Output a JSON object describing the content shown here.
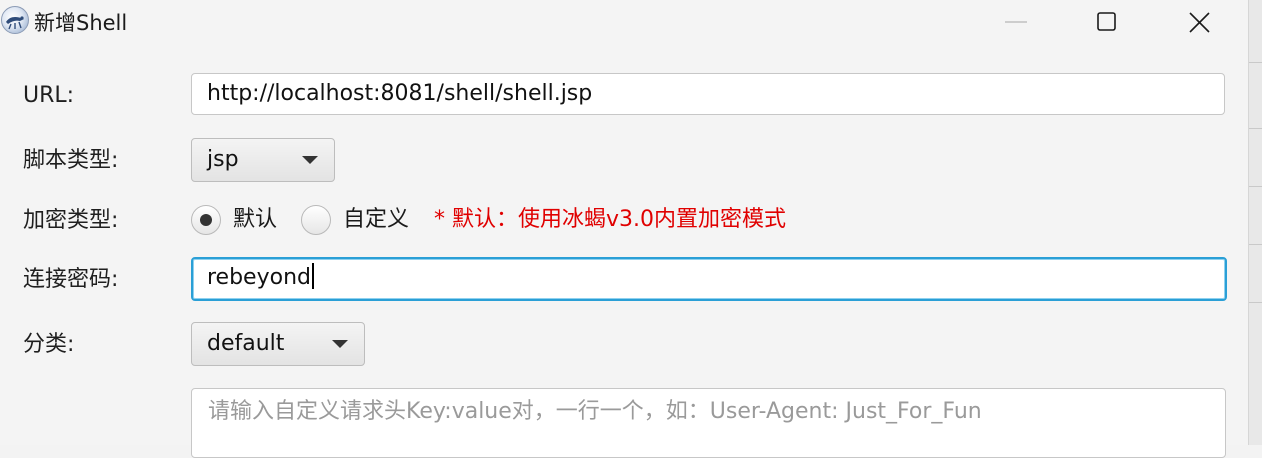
{
  "window": {
    "title": "新增Shell",
    "icons": {
      "app": "bug-shield-logo",
      "minimize": "minimize-icon",
      "maximize": "maximize-icon",
      "close": "close-icon"
    }
  },
  "form": {
    "url": {
      "label": "URL:",
      "value": "http://localhost:8081/shell/shell.jsp"
    },
    "script_type": {
      "label": "脚本类型:",
      "selected": "jsp"
    },
    "encrypt_type": {
      "label": "加密类型:",
      "options": [
        {
          "label": "默认",
          "checked": true
        },
        {
          "label": "自定义",
          "checked": false
        }
      ],
      "hint": "* 默认：使用冰蝎v3.0内置加密模式"
    },
    "password": {
      "label": "连接密码:",
      "value": "rebeyond"
    },
    "category": {
      "label": "分类:",
      "selected": "default"
    },
    "headers": {
      "placeholder": "请输入自定义请求头Key:value对，一行一个，如：User-Agent: Just_For_Fun"
    }
  },
  "colors": {
    "hint": "#e00000",
    "focus": "#2a9fd6"
  }
}
